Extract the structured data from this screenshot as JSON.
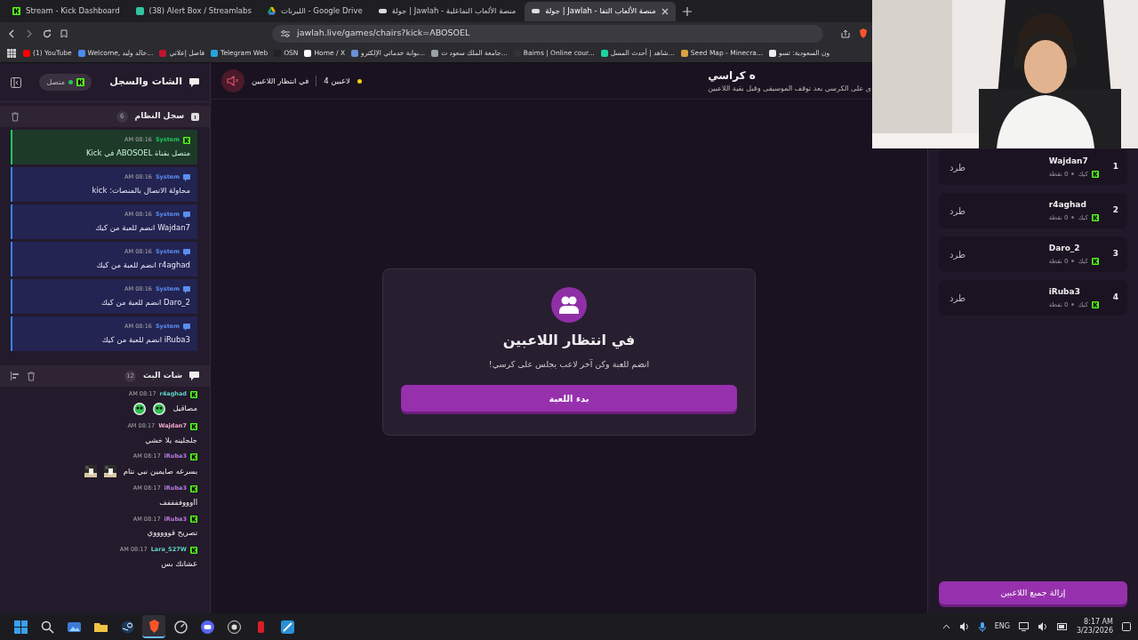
{
  "browser": {
    "tabs": [
      {
        "title": "جولة | Jawlah - منصة الألعاب التفا",
        "selected": true
      },
      {
        "title": "جولة | Jawlah - منصة الألعاب التفاعلية",
        "selected": false
      },
      {
        "title": "الليرنات - Google Drive",
        "selected": false
      },
      {
        "title": "(38) Alert Box / Streamlabs",
        "selected": false
      },
      {
        "title": "Stream - Kick Dashboard",
        "selected": false
      }
    ],
    "url": "jawlah.live/games/chairs?kick=ABOSOEL",
    "bookmarks": [
      {
        "title": "ون السعودية: تسو",
        "color": "#eeeeee"
      },
      {
        "title": "Seed Map - Minecra...",
        "color": "#d9a441"
      },
      {
        "title": "شاهد | أحدث المسل...",
        "color": "#1ed1a0"
      },
      {
        "title": "Baims | Online cour...",
        "color": "#333333"
      },
      {
        "title": "جامعة الملك سعود ت...",
        "color": "#9aa0a6"
      },
      {
        "title": "بوابة خدماتي الإلكترو...",
        "color": "#6b8fd6"
      },
      {
        "title": "Home / X",
        "color": "#ffffff"
      },
      {
        "title": "OSN",
        "color": "#222222"
      },
      {
        "title": "Telegram Web",
        "color": "#2aa3e0"
      },
      {
        "title": "فاصل إعلاني",
        "color": "#c0152f"
      },
      {
        "title": "Welcome, خالد وليد...",
        "color": "#4c8bf5"
      },
      {
        "title": "(1) YouTube",
        "color": "#ff0000"
      }
    ]
  },
  "sidebar": {
    "title": "الشات والسجل",
    "status": "متصل",
    "connected": true,
    "system_log": {
      "title": "سجل النظام",
      "count": "6",
      "entries": [
        {
          "source": "System",
          "time": "AM 08:16",
          "text": "متصل بقناة ABOSOEL في Kick",
          "kind": "kick"
        },
        {
          "source": "System",
          "time": "AM 08:16",
          "text": "محاولة الاتصال بالمنصات: kick",
          "kind": "system"
        },
        {
          "source": "System",
          "time": "AM 08:16",
          "text": "Wajdan7 انضم للعبة من كيك",
          "kind": "system"
        },
        {
          "source": "System",
          "time": "AM 08:16",
          "text": "r4aghad انضم للعبة من كيك",
          "kind": "system"
        },
        {
          "source": "System",
          "time": "AM 08:16",
          "text": "Daro_2 انضم للعبة من كيك",
          "kind": "system"
        },
        {
          "source": "System",
          "time": "AM 08:16",
          "text": "iRuba3 انضم للعبة من كيك",
          "kind": "system"
        }
      ]
    },
    "chat": {
      "title": "شات البث",
      "count": "12",
      "messages": [
        {
          "user": "r4aghad",
          "color": "#5ed1c4",
          "time": "AM 08:17",
          "text": "مصاقيل",
          "emotes": [
            {
              "kind": "sticker"
            },
            {
              "kind": "sticker"
            }
          ]
        },
        {
          "user": "Wajdan7",
          "color": "#f0a7c8",
          "time": "AM 08:17",
          "text": "جلجلينه يلا خشي"
        },
        {
          "user": "iRuba3",
          "color": "#b77de0",
          "time": "AM 08:17",
          "text": "بسرعه صايمين نبي نتام"
        },
        {
          "user": "iRuba3",
          "color": "#b77de0",
          "time": "AM 08:17",
          "text": "llوووففففف"
        },
        {
          "user": "iRuba3",
          "color": "#b77de0",
          "time": "AM 08:17",
          "text": "تصريح قوووووي"
        },
        {
          "user": "Lara_S27W",
          "color": "#5ed1c4",
          "time": "AM 08:17",
          "text": "عشانك بس"
        }
      ]
    }
  },
  "header": {
    "title": "ه كراسي",
    "subtitle": "ى على الكرسي بعد توقف الموسيقى وقبل بقية اللاعبين",
    "player_count": "4 لاعبين",
    "state": "في انتظار اللاعبين",
    "muted": true
  },
  "waiting_card": {
    "title": "في انتظار اللاعبين",
    "message": "انضم للعبة وكن آخر لاعب يجلس على كرسي!",
    "button": "بدء اللعبة"
  },
  "players": {
    "items": [
      {
        "rank": "1",
        "name": "Wajdan7",
        "platform": "كيك",
        "points": "0 نقطة",
        "action": "طرد"
      },
      {
        "rank": "2",
        "name": "r4aghad",
        "platform": "كيك",
        "points": "0 نقطة",
        "action": "طرد"
      },
      {
        "rank": "3",
        "name": "Daro_2",
        "platform": "كيك",
        "points": "0 نقطة",
        "action": "طرد"
      },
      {
        "rank": "4",
        "name": "iRuba3",
        "platform": "كيك",
        "points": "0 نقطة",
        "action": "طرد"
      }
    ],
    "remove_all": "إزالة جميع اللاعبين"
  },
  "taskbar": {
    "apps": [
      {
        "kind": "start",
        "selected": false
      },
      {
        "kind": "search",
        "selected": false
      },
      {
        "kind": "gallery",
        "selected": false
      },
      {
        "kind": "folder",
        "selected": false
      },
      {
        "kind": "steam",
        "selected": false
      },
      {
        "kind": "browser",
        "selected": true
      },
      {
        "kind": "chrome",
        "selected": false
      },
      {
        "kind": "discord",
        "selected": false
      },
      {
        "kind": "obs",
        "selected": false
      },
      {
        "kind": "red",
        "selected": false
      },
      {
        "kind": "tool",
        "selected": false
      }
    ],
    "language": "ENG",
    "time": "8:17 AM",
    "date": "3/23/2026"
  }
}
